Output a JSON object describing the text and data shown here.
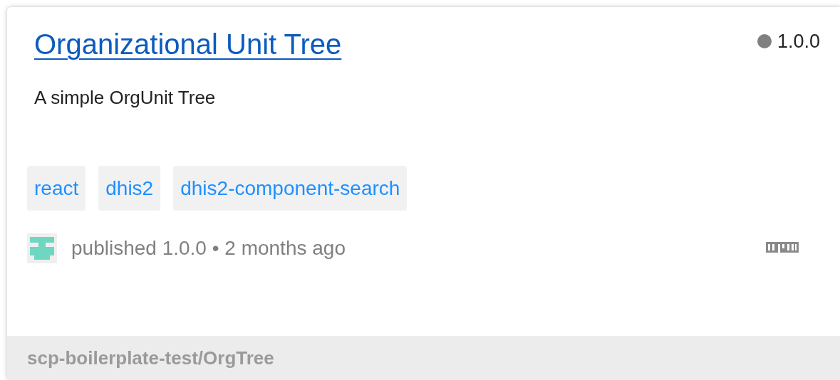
{
  "package": {
    "title": "Organizational Unit Tree",
    "version": {
      "text": "1.0.0",
      "color": "#808080"
    },
    "description": "A simple OrgUnit Tree",
    "tags": [
      "react",
      "dhis2",
      "dhis2-component-search"
    ],
    "published": "published 1.0.0 • 2 months ago",
    "footer": "scp-boilerplate-test/OrgTree"
  }
}
